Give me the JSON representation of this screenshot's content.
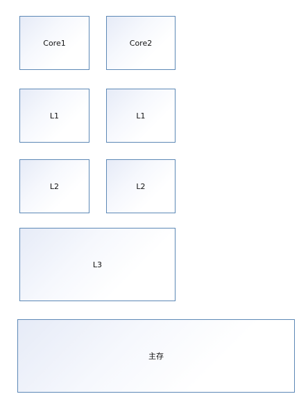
{
  "diagram": {
    "boxes": {
      "core1": "Core1",
      "core2": "Core2",
      "l1_left": "L1",
      "l1_right": "L1",
      "l2_left": "L2",
      "l2_right": "L2",
      "l3": "L3",
      "main_memory": "主存"
    },
    "colors": {
      "border": "#5b87b5",
      "fill_gradient_start": "#e6ebf7",
      "fill_gradient_end": "#ffffff",
      "text": "#111111"
    }
  }
}
